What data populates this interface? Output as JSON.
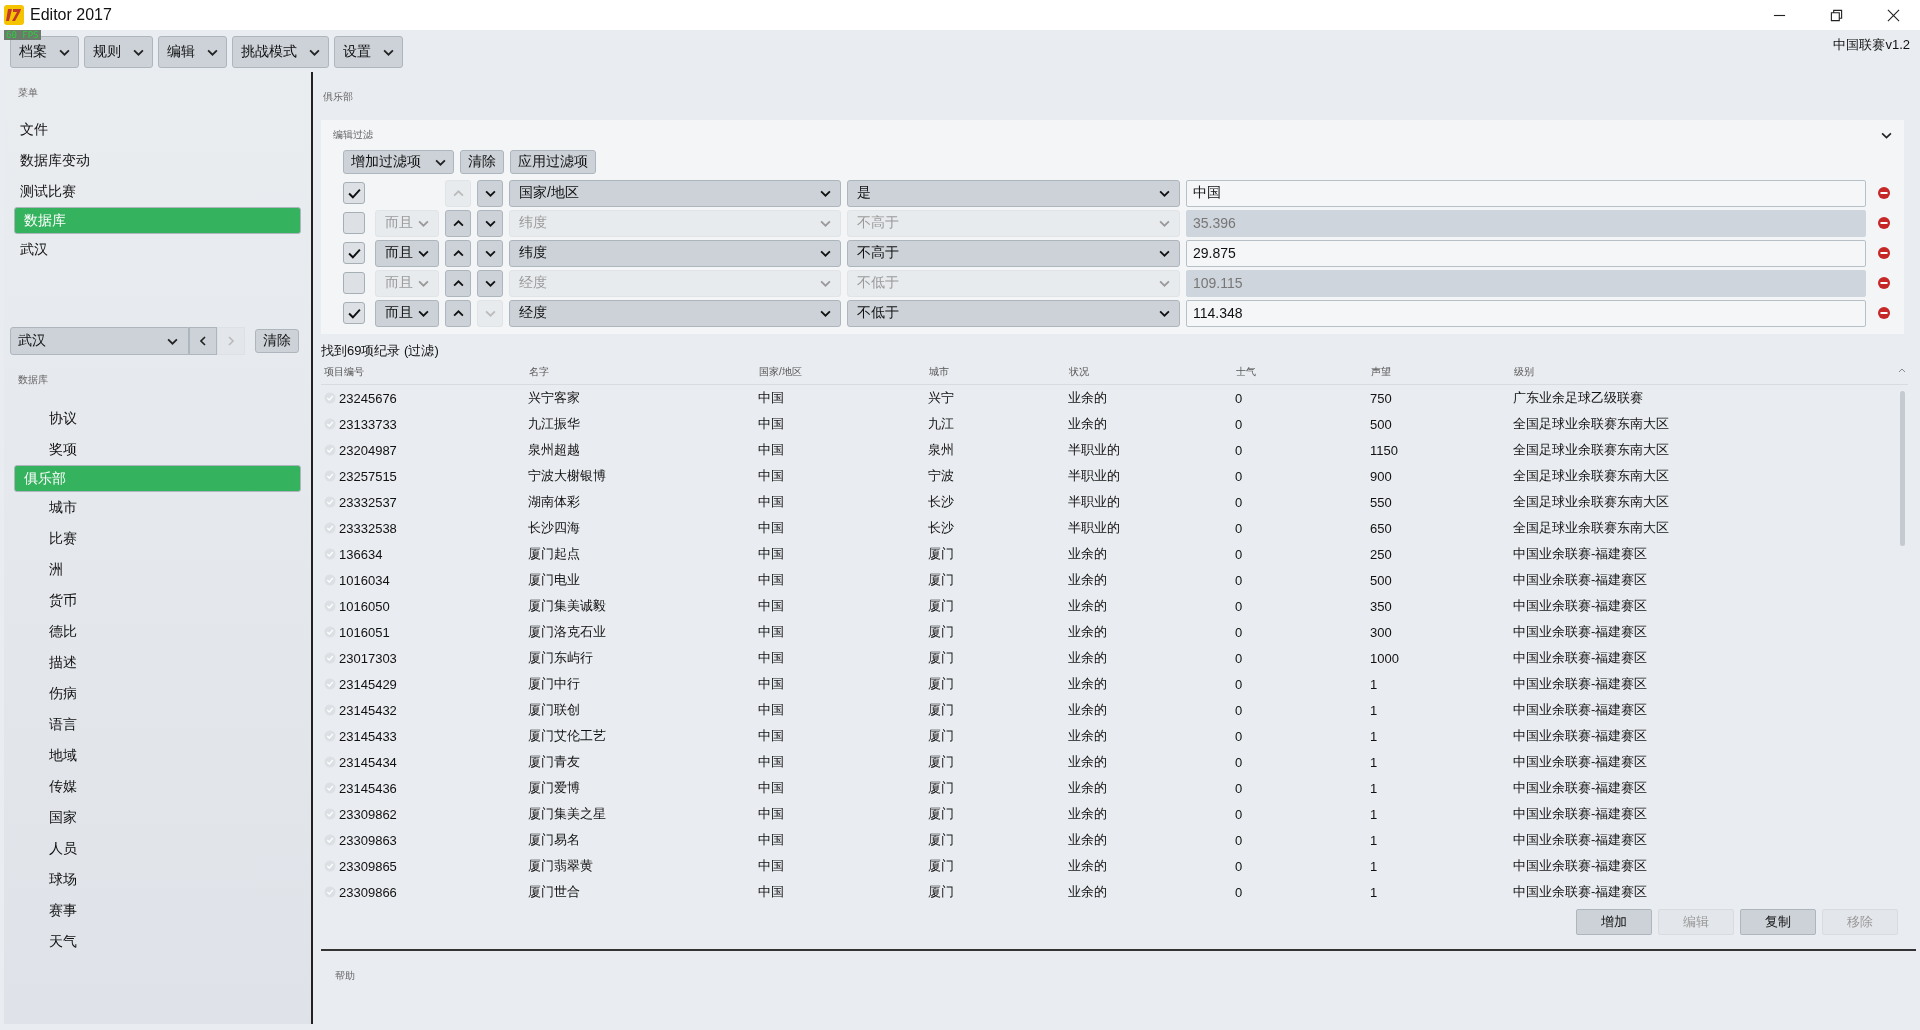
{
  "window": {
    "title": "Editor 2017",
    "fps": "60 FPS"
  },
  "menus": [
    {
      "label": "档案"
    },
    {
      "label": "规则"
    },
    {
      "label": "编辑"
    },
    {
      "label": "挑战模式"
    },
    {
      "label": "设置"
    }
  ],
  "version": "中国联赛v1.2",
  "sidebar": {
    "menu_label": "菜单",
    "menu_items": [
      {
        "label": "文件",
        "selected": false
      },
      {
        "label": "数据库变动",
        "selected": false
      },
      {
        "label": "测试比赛",
        "selected": false
      },
      {
        "label": "数据库",
        "selected": true
      },
      {
        "label": "武汉",
        "selected": false
      }
    ],
    "city_select": {
      "value": "武汉",
      "prev_disabled": false,
      "next_disabled": true,
      "clear": "清除"
    },
    "db_label": "数据库",
    "db_items": [
      {
        "label": "协议",
        "selected": false
      },
      {
        "label": "奖项",
        "selected": false
      },
      {
        "label": "俱乐部",
        "selected": true
      },
      {
        "label": "城市",
        "selected": false
      },
      {
        "label": "比赛",
        "selected": false
      },
      {
        "label": "洲",
        "selected": false
      },
      {
        "label": "货币",
        "selected": false
      },
      {
        "label": "德比",
        "selected": false
      },
      {
        "label": "描述",
        "selected": false
      },
      {
        "label": "伤病",
        "selected": false
      },
      {
        "label": "语言",
        "selected": false
      },
      {
        "label": "地域",
        "selected": false
      },
      {
        "label": "传媒",
        "selected": false
      },
      {
        "label": "国家",
        "selected": false
      },
      {
        "label": "人员",
        "selected": false
      },
      {
        "label": "球场",
        "selected": false
      },
      {
        "label": "赛事",
        "selected": false
      },
      {
        "label": "天气",
        "selected": false
      }
    ]
  },
  "section_title": "俱乐部",
  "filter": {
    "title": "编辑过滤",
    "expanded": true,
    "add": "增加过滤项",
    "clear": "清除",
    "apply": "应用过滤项",
    "rows": [
      {
        "checked": true,
        "up_disabled": true,
        "down_disabled": false,
        "field": "国家/地区",
        "operator": "是",
        "value": "中国"
      },
      {
        "checked": false,
        "conjunction": "而且",
        "up_disabled": false,
        "down_disabled": false,
        "field": "纬度",
        "operator": "不高于",
        "value": "35.396"
      },
      {
        "checked": true,
        "conjunction": "而且",
        "up_disabled": false,
        "down_disabled": false,
        "field": "纬度",
        "operator": "不高于",
        "value": "29.875"
      },
      {
        "checked": false,
        "conjunction": "而且",
        "up_disabled": false,
        "down_disabled": false,
        "field": "经度",
        "operator": "不低于",
        "value": "109.115"
      },
      {
        "checked": true,
        "conjunction": "而且",
        "up_disabled": false,
        "down_disabled": true,
        "field": "经度",
        "operator": "不低于",
        "value": "114.348"
      }
    ]
  },
  "result_count": "找到69项纪录 (过滤)",
  "table": {
    "columns": [
      "项目编号",
      "名字",
      "国家/地区",
      "城市",
      "状况",
      "士气",
      "声望",
      "级别"
    ],
    "rows": [
      [
        "23245676",
        "兴宁客家",
        "中国",
        "兴宁",
        "业余的",
        "0",
        "750",
        "广东业余足球乙级联赛"
      ],
      [
        "23133733",
        "九江振华",
        "中国",
        "九江",
        "业余的",
        "0",
        "500",
        "全国足球业余联赛东南大区"
      ],
      [
        "23204987",
        "泉州超越",
        "中国",
        "泉州",
        "半职业的",
        "0",
        "1150",
        "全国足球业余联赛东南大区"
      ],
      [
        "23257515",
        "宁波大榭银博",
        "中国",
        "宁波",
        "半职业的",
        "0",
        "900",
        "全国足球业余联赛东南大区"
      ],
      [
        "23332537",
        "湖南体彩",
        "中国",
        "长沙",
        "半职业的",
        "0",
        "550",
        "全国足球业余联赛东南大区"
      ],
      [
        "23332538",
        "长沙四海",
        "中国",
        "长沙",
        "半职业的",
        "0",
        "650",
        "全国足球业余联赛东南大区"
      ],
      [
        "136634",
        "厦门起点",
        "中国",
        "厦门",
        "业余的",
        "0",
        "250",
        "中国业余联赛-福建赛区"
      ],
      [
        "1016034",
        "厦门电业",
        "中国",
        "厦门",
        "业余的",
        "0",
        "500",
        "中国业余联赛-福建赛区"
      ],
      [
        "1016050",
        "厦门集美诚毅",
        "中国",
        "厦门",
        "业余的",
        "0",
        "350",
        "中国业余联赛-福建赛区"
      ],
      [
        "1016051",
        "厦门洛克石业",
        "中国",
        "厦门",
        "业余的",
        "0",
        "300",
        "中国业余联赛-福建赛区"
      ],
      [
        "23017303",
        "厦门东屿行",
        "中国",
        "厦门",
        "业余的",
        "0",
        "1000",
        "中国业余联赛-福建赛区"
      ],
      [
        "23145429",
        "厦门中行",
        "中国",
        "厦门",
        "业余的",
        "0",
        "1",
        "中国业余联赛-福建赛区"
      ],
      [
        "23145432",
        "厦门联创",
        "中国",
        "厦门",
        "业余的",
        "0",
        "1",
        "中国业余联赛-福建赛区"
      ],
      [
        "23145433",
        "厦门艾伦工艺",
        "中国",
        "厦门",
        "业余的",
        "0",
        "1",
        "中国业余联赛-福建赛区"
      ],
      [
        "23145434",
        "厦门青友",
        "中国",
        "厦门",
        "业余的",
        "0",
        "1",
        "中国业余联赛-福建赛区"
      ],
      [
        "23145436",
        "厦门爱博",
        "中国",
        "厦门",
        "业余的",
        "0",
        "1",
        "中国业余联赛-福建赛区"
      ],
      [
        "23309862",
        "厦门集美之星",
        "中国",
        "厦门",
        "业余的",
        "0",
        "1",
        "中国业余联赛-福建赛区"
      ],
      [
        "23309863",
        "厦门易名",
        "中国",
        "厦门",
        "业余的",
        "0",
        "1",
        "中国业余联赛-福建赛区"
      ],
      [
        "23309865",
        "厦门翡翠黄",
        "中国",
        "厦门",
        "业余的",
        "0",
        "1",
        "中国业余联赛-福建赛区"
      ],
      [
        "23309866",
        "厦门世合",
        "中国",
        "厦门",
        "业余的",
        "0",
        "1",
        "中国业余联赛-福建赛区"
      ]
    ]
  },
  "actions": [
    {
      "label": "增加",
      "disabled": false
    },
    {
      "label": "编辑",
      "disabled": true
    },
    {
      "label": "复制",
      "disabled": false
    },
    {
      "label": "移除",
      "disabled": true
    }
  ],
  "help_label": "帮助"
}
